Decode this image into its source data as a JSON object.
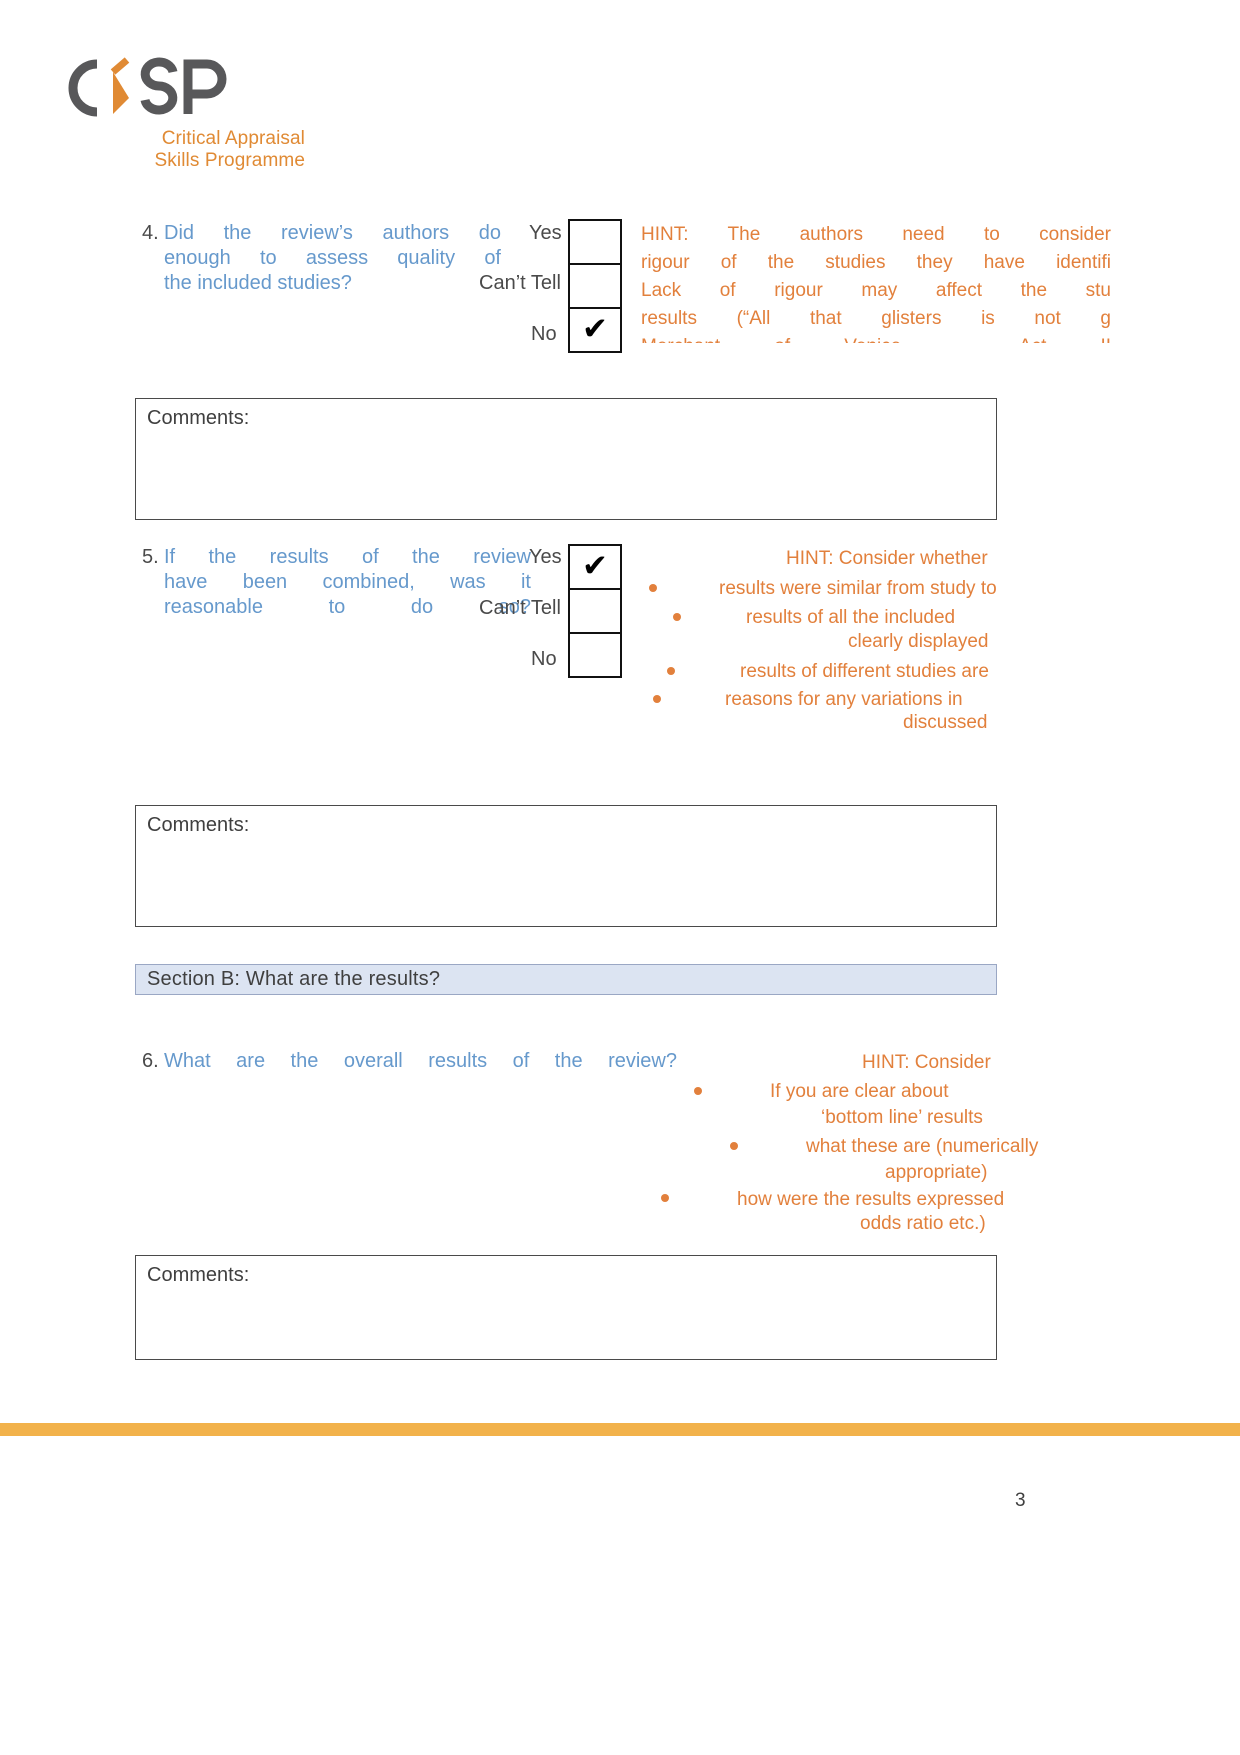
{
  "logo": {
    "wordmark": "CASP",
    "tagline_line1": "Critical Appraisal",
    "tagline_line2": "Skills Programme",
    "brand_orange": "#E08A34",
    "brand_grey": "#58585A"
  },
  "questions": [
    {
      "number": "4.",
      "text_lines": [
        "Did  the      review’s         authors do",
        "enough to      assess   quality  of",
        "the      included        studies?"
      ],
      "answers": [
        {
          "label": "Yes",
          "checked": false
        },
        {
          "label": "Can’t   Tell",
          "checked": false
        },
        {
          "label": "No",
          "checked": true
        }
      ],
      "hint_lines": [
        "HINT:   The      authors need   to      consider",
        "rigour  of      the      studies they    have    identified.",
        "Lack    of      rigour   may     affect  the     studies’",
        "results (“All    that    glisters is      not     gold” –",
        "Merchant  of    Venice  –       Act     II"
      ],
      "comments_label": "Comments:"
    },
    {
      "number": "5.",
      "text_lines": [
        "If     the     results of      the     review",
        "have    been   combined,      was     it",
        "reasonable      to      do      so?"
      ],
      "answers": [
        {
          "label": "Yes",
          "checked": true
        },
        {
          "label": "Can’t   Tell",
          "checked": false
        },
        {
          "label": "No",
          "checked": false
        }
      ],
      "hint_header": "HINT:   Consider        whether",
      "hint_bullets": [
        "results  were    similar from    study   to    study",
        "results  of      all     the     included      studies are\nclearly  displayed",
        "results  of      different       studies are    similar",
        "reasons for     any     variations     in    results are\ndiscussed"
      ],
      "comments_label": "Comments:"
    },
    {
      "number": "6.",
      "text_lines": [
        "What are     the     overall  results  of      the      review?"
      ],
      "hint_header": "HINT:   Consider",
      "hint_bullets": [
        "If      you     are     clear   about\n‘bottom line’     results",
        "what    these   are     (numerically if\nappropriate)",
        "how     were    the     results expressed (NNT,\nodds    ratio   etc.)"
      ],
      "comments_label": "Comments:"
    }
  ],
  "q4_hint_lines": [
    "HINT:   The      authors need   to      consider",
    "rigour  of      the      studies they    have    identified.",
    "Lack    of      rigour   may     affect  the     studies’",
    "results (“All    that    glisters is      not     gold” –",
    "Merchant  of    Venice  –       Act     II"
  ],
  "q4_hint_display": [
    "HINT:   The      authors need   to      consider",
    "rigour  of      the      studies they    have    identifi",
    "Lack    of      rigour   may     affect  the     stu",
    "results (“All    that    glisters is      not     g",
    "Merchant  of    Venice  –       Act     II"
  ],
  "q5_hint_display": [
    "HINT:   Consider        whether",
    "results  were    similar from    study   to",
    "results  of      all     the     included",
    "clearly  displayed",
    "results  of      different       studies are",
    "reasons for     any     variations      in",
    "discussed"
  ],
  "q6_hint_display": [
    "HINT:   Consider",
    "If      you     are     clear   about",
    "‘bottom line’     results",
    "what    these   are     (numerically",
    "appropriate)",
    "how     were    the     results expressed",
    "odds    ratio   etc.)"
  ],
  "section": {
    "label": "Section  B:       What    are      the      results?",
    "background": "#DCE4F2"
  },
  "comments_label": "Comments:",
  "footer": {
    "page_number": "3",
    "bar_color": "#F2B24B"
  },
  "colors": {
    "question_blue": "#6699CC",
    "hint_orange": "#E2803C",
    "text_grey": "#3f3f3f"
  }
}
